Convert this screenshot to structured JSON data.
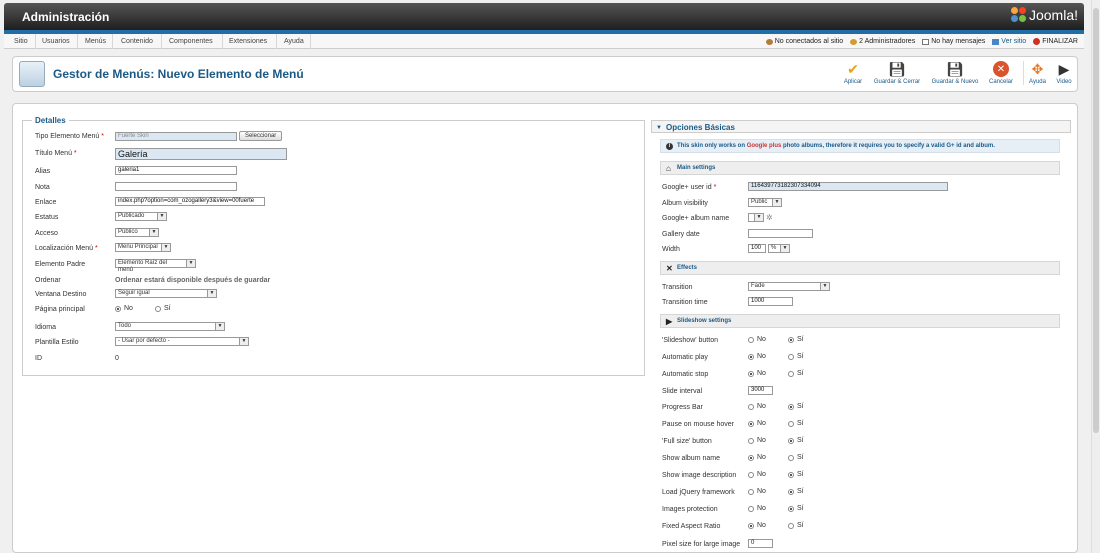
{
  "header": {
    "title": "Administración",
    "logo_text": "Joomla!"
  },
  "menu": [
    "Sitio",
    "Usuarios",
    "Menús",
    "Contenido",
    "Componentes",
    "Extensiones",
    "Ayuda"
  ],
  "status": {
    "not_connected": "No conectados al sitio",
    "admins": "2 Administradores",
    "messages": "No hay mensajes",
    "view_site": "Ver sitio",
    "logout": "FINALIZAR"
  },
  "toolbar": {
    "title": "Gestor de Menús: Nuevo Elemento de Menú",
    "apply": "Aplicar",
    "save_close": "Guardar & Cerrar",
    "save_new": "Guardar & Nuevo",
    "cancel": "Cancelar",
    "help": "Ayuda",
    "video": "Video"
  },
  "details": {
    "legend": "Detalles",
    "type_label": "Tipo Elemento Menú",
    "type_value": "Fuerte Skin",
    "select_btn": "Seleccionar",
    "title_label": "Título Menú",
    "title_value": "Galería",
    "alias_label": "Alias",
    "alias_value": "galeria1",
    "note_label": "Nota",
    "note_value": "",
    "link_label": "Enlace",
    "link_value": "index.php?option=com_ozogallery3&view=00fuerte",
    "status_label": "Estatus",
    "status_value": "Publicado",
    "access_label": "Acceso",
    "access_value": "Público",
    "location_label": "Localización Menú",
    "location_value": "Menu Principal",
    "parent_label": "Elemento Padre",
    "parent_value": "Elemento Raíz del menú",
    "order_label": "Ordenar",
    "order_text": "Ordenar estará disponible después de guardar",
    "target_label": "Ventana Destino",
    "target_value": "Seguir igual",
    "home_label": "Página principal",
    "no": "No",
    "yes": "Sí",
    "language_label": "Idioma",
    "language_value": "Todo",
    "template_label": "Plantilla Estilo",
    "template_value": "- Usar por defecto -",
    "id_label": "ID",
    "id_value": "0"
  },
  "options": {
    "title": "Opciones Básicas",
    "note_a": "This skin only works on ",
    "note_gp": "Google plus",
    "note_b": " photo albums, therefore it requires you to specify a valid G+ id and album.",
    "main_settings": "Main settings",
    "userid_label": "Google+ user id",
    "userid_value": "116439773182307334094",
    "visibility_label": "Album visibility",
    "visibility_value": "Public",
    "album_label": "Google+ album name",
    "date_label": "Gallery date",
    "width_label": "Width",
    "width_value": "100",
    "width_unit": "%",
    "effects": "Effects",
    "transition_label": "Transition",
    "transition_value": "Fade",
    "transition_time_label": "Transition time",
    "transition_time_value": "1000",
    "slideshow_settings": "Slideshow settings",
    "no": "No",
    "yes": "Sí",
    "slideshow_button": "'Slideshow' button",
    "autoplay": "Automatic play",
    "autostop": "Automatic stop",
    "interval_label": "Slide interval",
    "interval_value": "3000",
    "progress": "Progress Bar",
    "pause": "Pause on mouse hover",
    "fullsize": "'Full size' button",
    "show_album": "Show album name",
    "show_desc": "Show image description",
    "jquery": "Load jQuery framework",
    "protection": "Images protection",
    "aspect": "Fixed Aspect Ratio",
    "pixel_label": "Pixel size for large image",
    "pixel_value": "0"
  },
  "colors": {
    "accent": "#1b5a87",
    "topbar_blue": "#1f6ea8",
    "apply": "#e8a317",
    "cancel": "#d9532c"
  }
}
